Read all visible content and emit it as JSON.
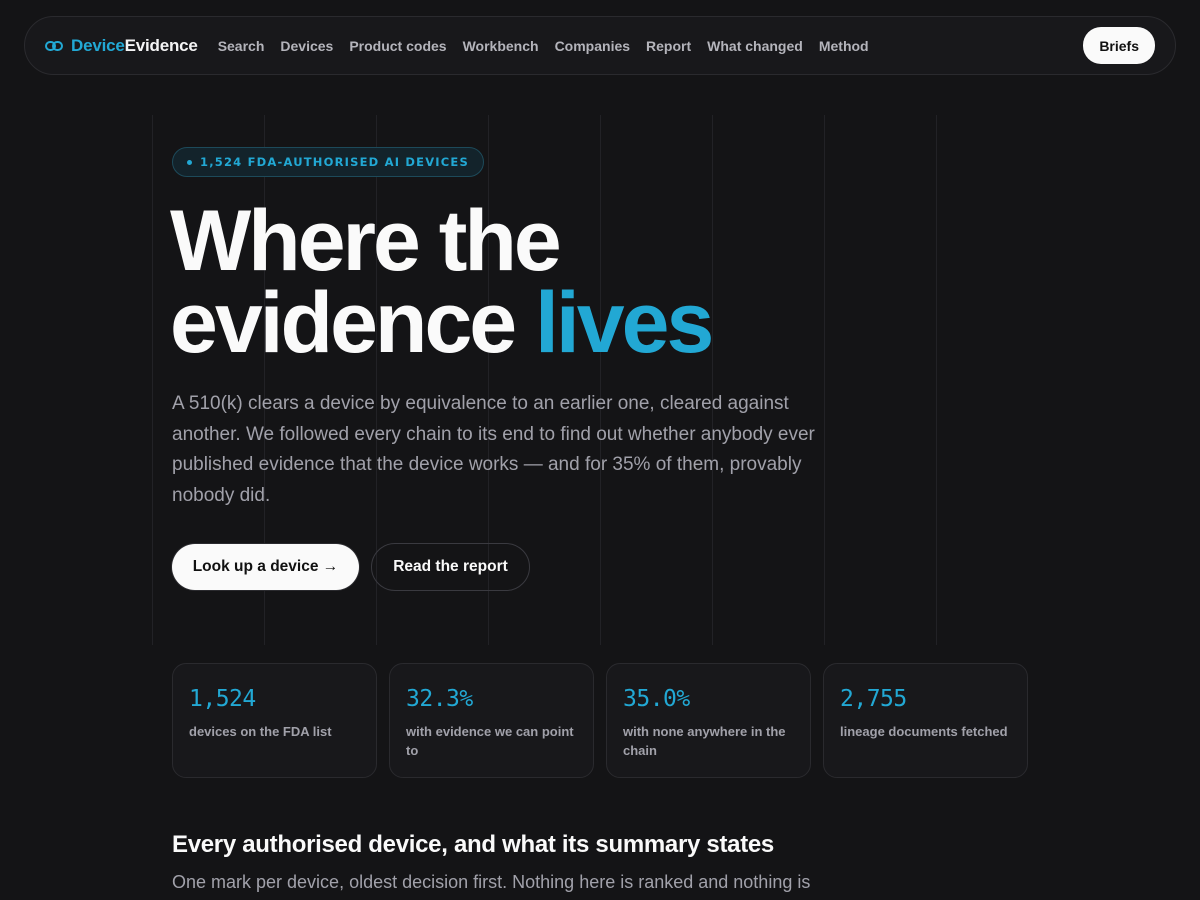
{
  "nav": {
    "brand_accent": "Device",
    "brand_main": "Evidence",
    "links": [
      "Search",
      "Devices",
      "Product codes",
      "Workbench",
      "Companies",
      "Report",
      "What changed",
      "Method"
    ],
    "cta": "Briefs"
  },
  "hero": {
    "badge": "1,524 FDA-AUTHORISED AI DEVICES",
    "title_line1": "Where the",
    "title_line2_a": "evidence ",
    "title_line2_b": "lives",
    "subtitle": "A 510(k) clears a device by equivalence to an earlier one, cleared against another. We followed every chain to its end to find out whether anybody ever published evidence that the device works — and for 35% of them, provably nobody did.",
    "primary_button": "Look up a device →",
    "secondary_button": "Read the report"
  },
  "stats": [
    {
      "value": "1,524",
      "label": "devices on the FDA list"
    },
    {
      "value": "32.3%",
      "label": "with evidence we can point to"
    },
    {
      "value": "35.0%",
      "label": "with none anywhere in the chain"
    },
    {
      "value": "2,755",
      "label": "lineage documents fetched"
    }
  ],
  "section": {
    "title": "Every authorised device, and what its summary states",
    "subtitle": "One mark per device, oldest decision first. Nothing here is ranked and nothing is"
  },
  "colors": {
    "background": "#141416",
    "accent": "#22a8d4",
    "text": "#fafafa",
    "muted": "#a1a1aa"
  }
}
